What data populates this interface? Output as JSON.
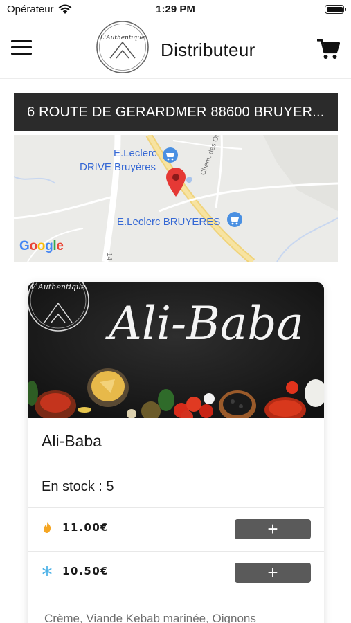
{
  "status_bar": {
    "carrier": "Opérateur",
    "time": "1:29 PM"
  },
  "header": {
    "title": "Distributeur",
    "logo_text": "L'Authentique"
  },
  "address": {
    "text": "6 ROUTE DE GERARDMER 88600 BRUYER..."
  },
  "map": {
    "places": [
      {
        "line1": "E.Leclerc",
        "line2": "DRIVE Bruyères"
      },
      {
        "line1": "E.Leclerc BRUYERES"
      }
    ],
    "road_label": "Chem. des Odes Fées",
    "road_number": "14",
    "provider": "Google"
  },
  "product": {
    "banner_title": "Ali-Baba",
    "banner_logo": "L'Authentique",
    "name": "Ali-Baba",
    "stock": "En stock : 5",
    "prices": [
      {
        "mode": "hot",
        "icon": "flame-icon",
        "value": "11.00",
        "currency": "€",
        "button": "+"
      },
      {
        "mode": "frozen",
        "icon": "snowflake-icon",
        "value": "10.50",
        "currency": "€",
        "button": "+"
      }
    ],
    "ingredients": "Crème, Viande Kebab marinée, Oignons"
  },
  "colors": {
    "address_bar": "#2b2b2b",
    "add_button": "#5a5a5a",
    "flame": "#f5a623",
    "snowflake": "#4fb3e8",
    "map_link": "#3568d4",
    "map_pin": "#e53935"
  }
}
